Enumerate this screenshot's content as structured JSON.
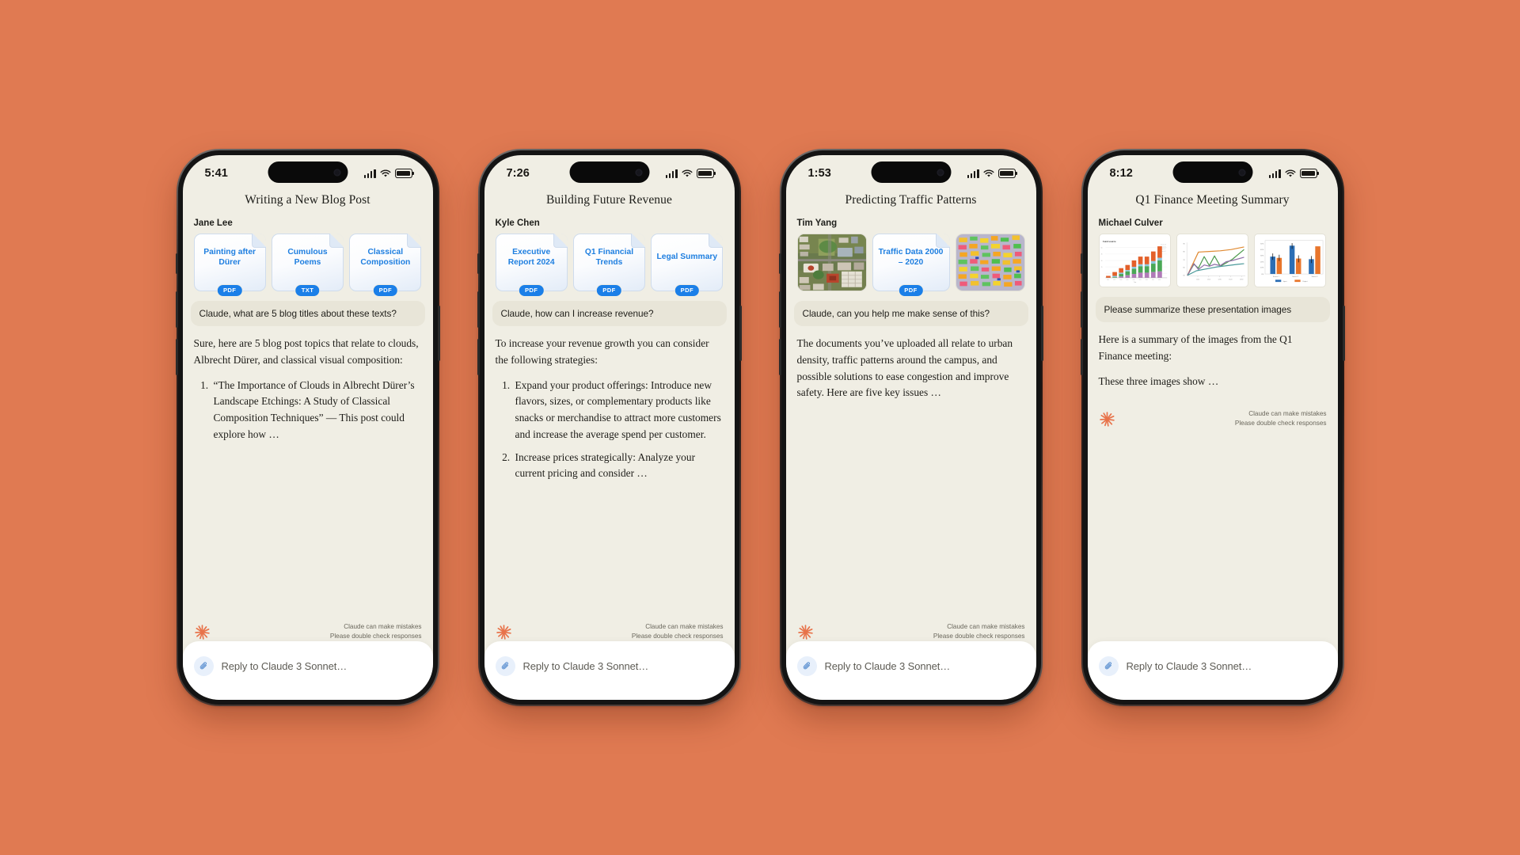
{
  "background_color": "#e07a52",
  "brand": {
    "accent": "#e8734a",
    "link_blue": "#1f7fe0",
    "badge_blue": "#1b7fe8"
  },
  "shared": {
    "composer_placeholder": "Reply to Claude 3 Sonnet…",
    "disclaimer_line1": "Claude can make mistakes",
    "disclaimer_line2": "Please double check responses",
    "clip_icon": "paperclip-icon",
    "claude_logo": "claude-sunburst-logo"
  },
  "phones": [
    {
      "status": {
        "time": "5:41",
        "signal": "cellular-signal-icon",
        "wifi": "wifi-icon",
        "battery": "battery-icon"
      },
      "title": "Writing a New Blog Post",
      "sender": "Jane Lee",
      "attachments": [
        {
          "kind": "doc",
          "name": "Painting after Dürer",
          "badge": "PDF"
        },
        {
          "kind": "doc",
          "name": "Cumulous Poems",
          "badge": "TXT"
        },
        {
          "kind": "doc",
          "name": "Classical Composition",
          "badge": "PDF"
        }
      ],
      "user_message": "Claude, what are 5 blog titles about these texts?",
      "reply_intro": "Sure, here are 5 blog post topics that relate to clouds, Albrecht Dürer, and classical visual composition:",
      "reply_items": [
        "“The Importance of Clouds in Albrecht Dürer’s Landscape Etchings: A Study of Classical Composition Techniques” — This post could explore how …"
      ]
    },
    {
      "status": {
        "time": "7:26",
        "signal": "cellular-signal-icon",
        "wifi": "wifi-icon",
        "battery": "battery-icon"
      },
      "title": "Building Future Revenue",
      "sender": "Kyle Chen",
      "attachments": [
        {
          "kind": "doc",
          "name": "Executive Report 2024",
          "badge": "PDF"
        },
        {
          "kind": "doc",
          "name": "Q1 Financial Trends",
          "badge": "PDF"
        },
        {
          "kind": "doc",
          "name": "Legal Summary",
          "badge": "PDF"
        }
      ],
      "user_message": "Claude, how can I increase revenue?",
      "reply_intro": "To increase your revenue growth you can consider the following strategies:",
      "reply_items": [
        "Expand your product offerings: Introduce new flavors, sizes, or complementary products like snacks or merchandise to attract more customers and increase the average spend per customer.",
        "Increase prices strategically: Analyze your current pricing and consider …"
      ]
    },
    {
      "status": {
        "time": "1:53",
        "signal": "cellular-signal-icon",
        "wifi": "wifi-icon",
        "battery": "battery-icon"
      },
      "title": "Predicting Traffic Patterns",
      "sender": "Tim Yang",
      "attachments": [
        {
          "kind": "photo-aerial",
          "name": "aerial-campus-photo"
        },
        {
          "kind": "doc",
          "name": "Traffic Data 2000 – 2020",
          "badge": "PDF"
        },
        {
          "kind": "photo-stickies",
          "name": "sticky-notes-wall-photo"
        }
      ],
      "user_message": "Claude, can you help me make sense of this?",
      "reply_intro": "The documents you’ve uploaded all relate to urban density, traffic patterns around the campus, and possible solutions to ease congestion and improve safety. Here are five key issues …",
      "reply_items": []
    },
    {
      "status": {
        "time": "8:12",
        "signal": "cellular-signal-icon",
        "wifi": "wifi-icon",
        "battery": "battery-icon"
      },
      "title": "Q1 Finance Meeting Summary",
      "sender": "Michael Culver",
      "attachments": [
        {
          "kind": "chart-stacked-bar",
          "name": "stacked-bar-chart-thumbnail",
          "caption": "Fund source"
        },
        {
          "kind": "chart-line",
          "name": "multi-line-chart-thumbnail"
        },
        {
          "kind": "chart-grouped-bar",
          "name": "grouped-bar-chart-thumbnail"
        }
      ],
      "user_message": "Please summarize these presentation images",
      "reply_intro": "Here is a summary of the images from the Q1 Finance meeting:",
      "reply_items": [],
      "reply_outro": "These three images show …"
    }
  ],
  "chart_data": [
    {
      "type": "bar",
      "title": "Fund source",
      "stacked": true,
      "categories": [
        "2016",
        "2017",
        "2018",
        "2019",
        "2020",
        "2021",
        "2022",
        "2023",
        "2024"
      ],
      "series": [
        {
          "name": "A",
          "color": "#b07ab8",
          "values": [
            0,
            2,
            4,
            8,
            14,
            20,
            21,
            26,
            30
          ]
        },
        {
          "name": "B",
          "color": "#4aa856",
          "values": [
            1,
            6,
            12,
            18,
            26,
            38,
            38,
            46,
            58
          ]
        },
        {
          "name": "C",
          "color": "#8fc7dd",
          "values": [
            0,
            1,
            2,
            3,
            5,
            8,
            9,
            11,
            14
          ]
        },
        {
          "name": "D",
          "color": "#e3602a",
          "values": [
            3,
            12,
            16,
            20,
            26,
            33,
            34,
            46,
            56
          ]
        }
      ],
      "xlabel": "",
      "ylabel": ""
    },
    {
      "type": "line",
      "title": "",
      "x": [
        "1050",
        "1250",
        "1470",
        "1620",
        "1890",
        "2100"
      ],
      "ytick_labels": [
        "90",
        "80",
        "70",
        "60",
        "50"
      ],
      "series": [
        {
          "name": "orange",
          "color": "#e08a32",
          "values": [
            50,
            77,
            78,
            79,
            81,
            84
          ]
        },
        {
          "name": "green",
          "color": "#4d9a4d",
          "values": [
            50,
            62,
            70,
            60,
            70,
            58,
            76
          ]
        },
        {
          "name": "purple",
          "color": "#8f6fa8",
          "values": [
            50,
            62,
            56,
            62,
            60,
            62,
            70
          ]
        },
        {
          "name": "teal",
          "color": "#4a9a9a",
          "values": [
            50,
            53,
            55,
            57,
            58,
            60,
            62
          ]
        }
      ]
    },
    {
      "type": "bar",
      "grouped": true,
      "categories": [
        "Source 1",
        "Source 2",
        "Source 3"
      ],
      "ytick_labels": [
        "0%",
        "10%",
        "20%",
        "30%",
        "40%",
        "50%"
      ],
      "ylim": [
        0,
        55
      ],
      "series": [
        {
          "name": "Input",
          "color": "#2b6eb5",
          "values": [
            29,
            48,
            23
          ]
        },
        {
          "name": "Output",
          "color": "#e8762c",
          "values": [
            27,
            26,
            47
          ]
        }
      ],
      "error_bars": true,
      "legend_position": "bottom"
    }
  ]
}
